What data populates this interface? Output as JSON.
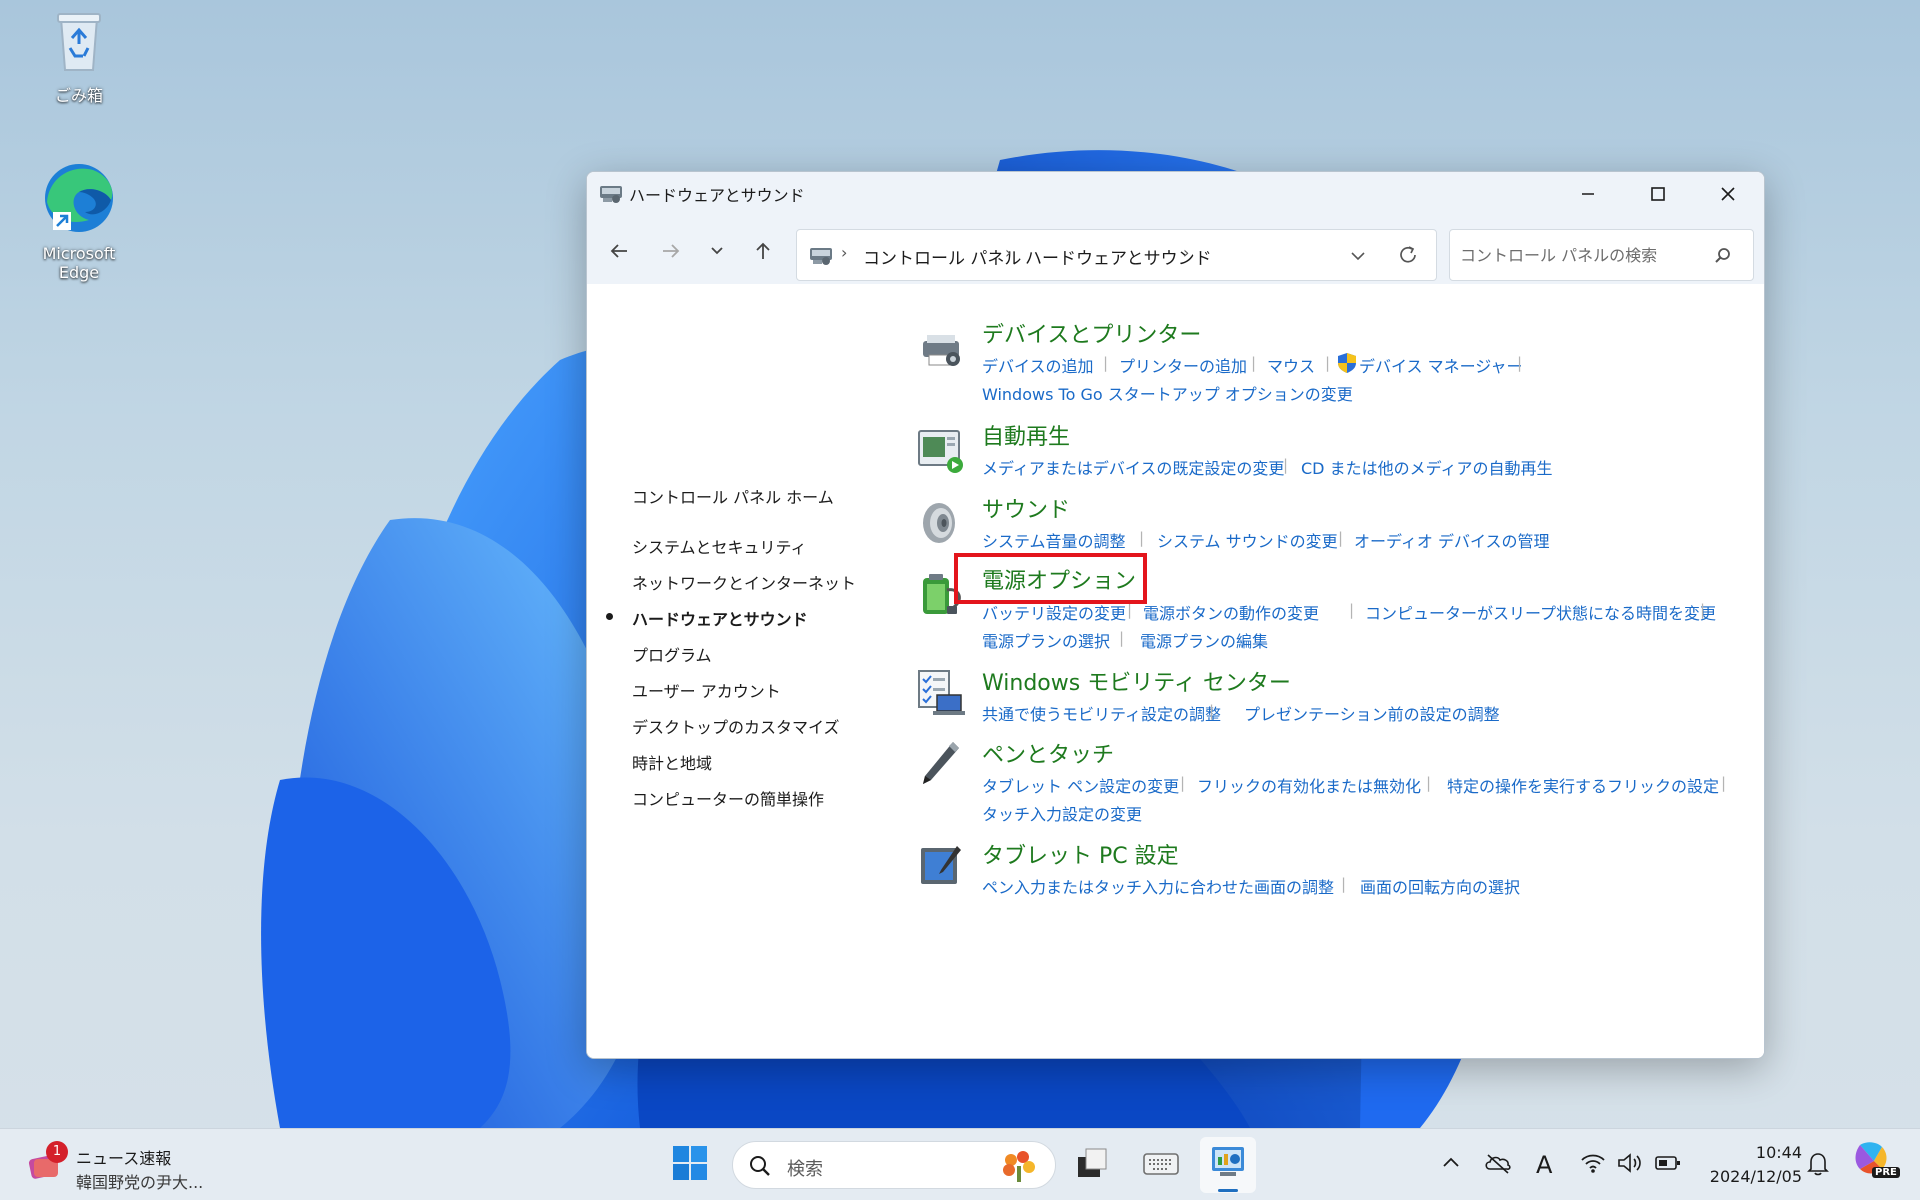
{
  "desktop": {
    "icons": [
      {
        "label": "ごみ箱",
        "icon": "recycle-bin-icon"
      },
      {
        "label": "Microsoft Edge",
        "icon": "edge-icon"
      }
    ]
  },
  "window": {
    "title": "ハードウェアとサウンド",
    "icon": "control-panel-icon",
    "controls": {
      "minimize": "minimize-icon",
      "maximize": "maximize-icon",
      "close": "close-icon"
    }
  },
  "navigation": {
    "breadcrumb": [
      "コントロール パネル",
      "ハードウェアとサウンド"
    ],
    "search_placeholder": "コントロール パネルの検索"
  },
  "sidebar": {
    "home": "コントロール パネル ホーム",
    "items": [
      {
        "label": "システムとセキュリティ",
        "current": false
      },
      {
        "label": "ネットワークとインターネット",
        "current": false
      },
      {
        "label": "ハードウェアとサウンド",
        "current": true
      },
      {
        "label": "プログラム",
        "current": false
      },
      {
        "label": "ユーザー アカウント",
        "current": false
      },
      {
        "label": "デスクトップのカスタマイズ",
        "current": false
      },
      {
        "label": "時計と地域",
        "current": false
      },
      {
        "label": "コンピューターの簡単操作",
        "current": false
      }
    ]
  },
  "categories": [
    {
      "title": "デバイスとプリンター",
      "icon": "devices-printers-icon",
      "links": [
        "デバイスの追加",
        "プリンターの追加",
        "マウス",
        "デバイス マネージャー",
        "Windows To Go スタートアップ オプションの変更"
      ]
    },
    {
      "title": "自動再生",
      "icon": "autoplay-icon",
      "links": [
        "メディアまたはデバイスの既定設定の変更",
        "CD または他のメディアの自動再生"
      ]
    },
    {
      "title": "サウンド",
      "icon": "speaker-icon",
      "links": [
        "システム音量の調整",
        "システム サウンドの変更",
        "オーディオ デバイスの管理"
      ]
    },
    {
      "title": "電源オプション",
      "icon": "power-options-icon",
      "highlighted": true,
      "links": [
        "バッテリ設定の変更",
        "電源ボタンの動作の変更",
        "コンピューターがスリープ状態になる時間を変更",
        "電源プランの選択",
        "電源プランの編集"
      ]
    },
    {
      "title": "Windows モビリティ センター",
      "icon": "mobility-center-icon",
      "links": [
        "共通で使うモビリティ設定の調整",
        "プレゼンテーション前の設定の調整"
      ]
    },
    {
      "title": "ペンとタッチ",
      "icon": "pen-icon",
      "links": [
        "タブレット ペン設定の変更",
        "フリックの有効化または無効化",
        "特定の操作を実行するフリックの設定",
        "タッチ入力設定の変更"
      ]
    },
    {
      "title": "タブレット PC 設定",
      "icon": "tablet-pc-icon",
      "links": [
        "ペン入力またはタッチ入力に合わせた画面の調整",
        "画面の回転方向の選択"
      ]
    }
  ],
  "taskbar": {
    "news": {
      "badge": "1",
      "title": "ニュース速報",
      "subtitle": "韓国野党の尹大..."
    },
    "search_placeholder": "検索",
    "ime": "A",
    "time": "10:44",
    "date": "2024/12/05",
    "copilot_badge": "PRE"
  },
  "colors": {
    "category_title": "#1e7a1e",
    "link": "#1a6ac8",
    "highlight_box": "#e3151c"
  }
}
